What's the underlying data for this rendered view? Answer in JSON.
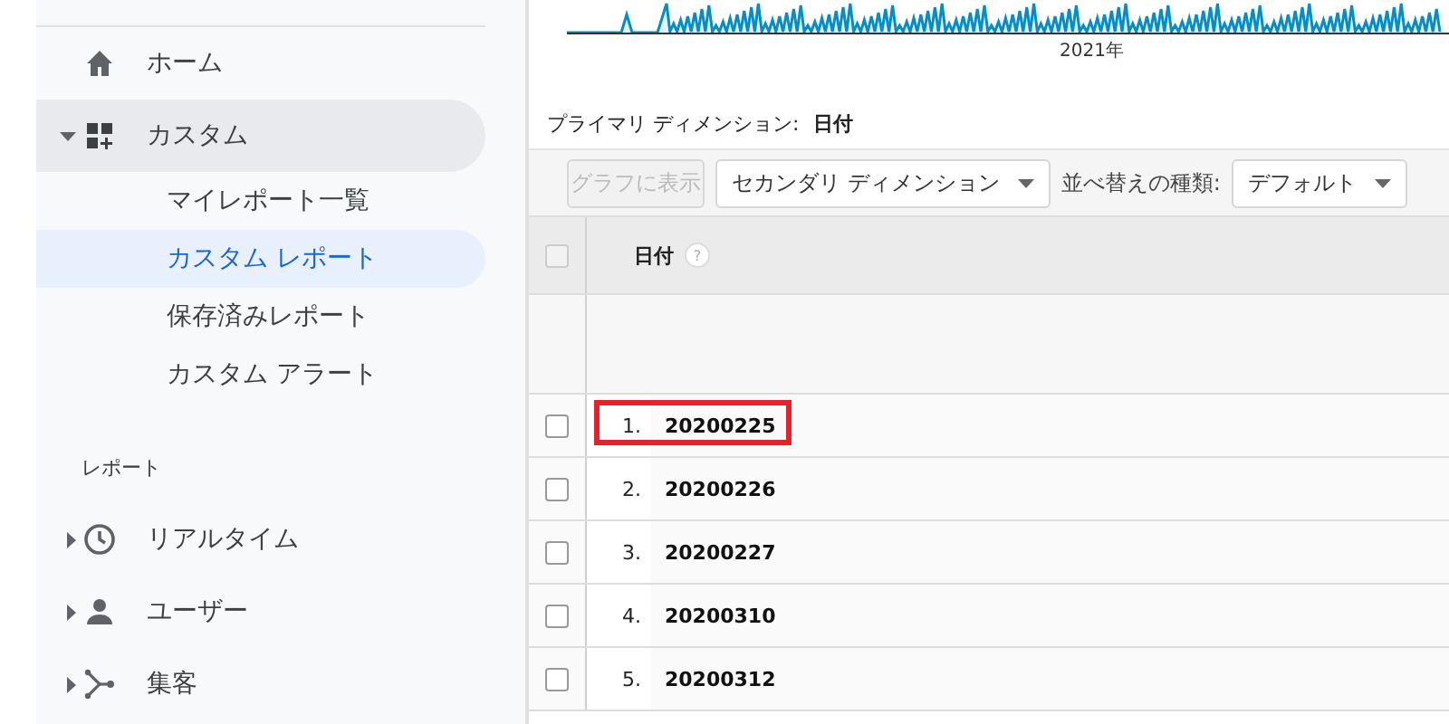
{
  "sidebar": {
    "items": [
      {
        "label": "ホーム",
        "selected": false
      },
      {
        "label": "カスタム",
        "selected": true,
        "expanded": true,
        "children": [
          {
            "label": "マイレポート一覧",
            "selected": false
          },
          {
            "label": "カスタム レポート",
            "selected": true
          },
          {
            "label": "保存済みレポート",
            "selected": false
          },
          {
            "label": "カスタム アラート",
            "selected": false
          }
        ]
      }
    ],
    "section_label": "レポート",
    "report_items": [
      {
        "label": "リアルタイム",
        "expanded": false
      },
      {
        "label": "ユーザー",
        "expanded": false
      },
      {
        "label": "集客",
        "expanded": false
      }
    ]
  },
  "chart": {
    "x_label": "2021年"
  },
  "primary_dimension": {
    "label": "プライマリ ディメンション:",
    "value": "日付"
  },
  "toolbar": {
    "graph_button": {
      "label": "グラフに表示",
      "disabled": true
    },
    "secondary_dropdown": "セカンダリ ディメンション",
    "sort_label": "並べ替えの種類:",
    "sort_dropdown": "デフォルト"
  },
  "table": {
    "header": {
      "checked": false,
      "column": "日付",
      "help": "?"
    },
    "rows": [
      {
        "index": "1.",
        "value": "20200225",
        "checked": false,
        "highlighted": true
      },
      {
        "index": "2.",
        "value": "20200226",
        "checked": false,
        "highlighted": false
      },
      {
        "index": "3.",
        "value": "20200227",
        "checked": false,
        "highlighted": false
      },
      {
        "index": "4.",
        "value": "20200310",
        "checked": false,
        "highlighted": false
      },
      {
        "index": "5.",
        "value": "20200312",
        "checked": false,
        "highlighted": false
      }
    ]
  }
}
